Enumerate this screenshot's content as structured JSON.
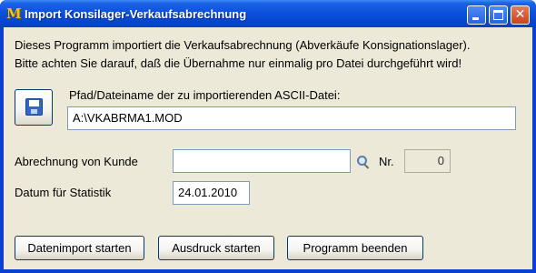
{
  "window": {
    "title": "Import Konsilager-Verkaufsabrechnung",
    "app_icon": "M",
    "controls": {
      "minimize": "minimize-icon",
      "maximize": "maximize-icon",
      "close": "close-icon"
    }
  },
  "intro": {
    "line1": "Dieses Programm importiert die Verkaufsabrechnung (Abverkäufe Konsignationslager).",
    "line2": "Bitte achten Sie darauf, daß die Übernahme nur einmalig pro Datei durchgeführt wird!"
  },
  "file": {
    "label": "Pfad/Dateiname der zu importierenden ASCII-Datei:",
    "value": "A:\\VKABRMA1.MOD",
    "browse_icon": "floppy-disk-icon"
  },
  "customer": {
    "label": "Abrechnung von Kunde",
    "value": "",
    "search_icon": "magnifier-icon",
    "nr_label": "Nr.",
    "nr_value": "0"
  },
  "date": {
    "label": "Datum für Statistik",
    "value": "24.01.2010"
  },
  "buttons": {
    "import": "Datenimport starten",
    "print": "Ausdruck starten",
    "exit": "Programm beenden"
  },
  "colors": {
    "titlebar": "#0a4fdc",
    "dialog_bg": "#ece9d8",
    "app_icon": "#f4c20d"
  }
}
